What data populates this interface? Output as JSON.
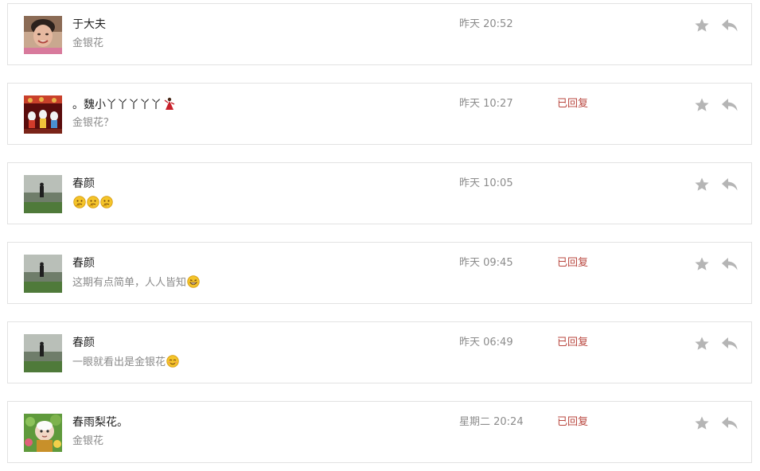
{
  "messages": [
    {
      "name": "于大夫",
      "text": "金银花",
      "time": "昨天 20:52",
      "status": "",
      "emojis": [],
      "avatar": "avatar-woman-portrait"
    },
    {
      "name": "。魏小丫丫丫丫丫",
      "text": "金银花？",
      "time": "昨天 10:27",
      "status": "已回复",
      "emojis": [],
      "avatar": "avatar-cartoon-figures"
    },
    {
      "name": "春颜",
      "text": "",
      "time": "昨天 10:05",
      "status": "",
      "emojis": [
        "thinking-emoji",
        "thinking-emoji",
        "thinking-emoji"
      ],
      "avatar": "avatar-landscape-person"
    },
    {
      "name": "春颜",
      "text": "这期有点简单，人人皆知",
      "time": "昨天 09:45",
      "status": "已回复",
      "emojis": [
        "grin-emoji"
      ],
      "avatar": "avatar-landscape-person"
    },
    {
      "name": "春颜",
      "text": "一眼就看出是金银花",
      "time": "昨天 06:49",
      "status": "已回复",
      "emojis": [
        "smile-emoji"
      ],
      "avatar": "avatar-landscape-person"
    },
    {
      "name": "春雨梨花。",
      "text": "金银花",
      "time": "星期二 20:24",
      "status": "已回复",
      "emojis": [],
      "avatar": "avatar-cartoon-monk"
    }
  ],
  "icons": {
    "star": "star-icon",
    "reply": "reply-arrow-icon",
    "dancer": "flamenco-dancer-emoji"
  },
  "colors": {
    "replied": "#b9473f",
    "icon": "#b5b5b5",
    "border": "#e2e2e2"
  }
}
